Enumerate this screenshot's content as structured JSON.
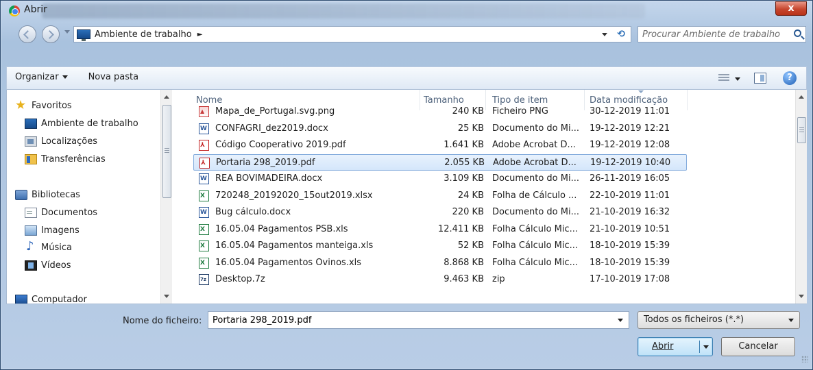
{
  "window": {
    "title": "Abrir",
    "close_label": "x"
  },
  "address_bar": {
    "path": "Ambiente de trabalho",
    "separator": "►"
  },
  "search": {
    "placeholder": "Procurar Ambiente de trabalho"
  },
  "toolbar": {
    "organize_label": "Organizar",
    "new_folder_label": "Nova pasta",
    "help_label": "?"
  },
  "nav": {
    "favorites": "Favoritos",
    "desktop": "Ambiente de trabalho",
    "places": "Localizações",
    "downloads": "Transferências",
    "libraries": "Bibliotecas",
    "documents": "Documentos",
    "images": "Imagens",
    "music": "Música",
    "videos": "Vídeos",
    "computer": "Computador"
  },
  "columns": {
    "name": "Nome",
    "size": "Tamanho",
    "type": "Tipo de item",
    "date": "Data modificação"
  },
  "files": [
    {
      "icon": "png-file-icon",
      "name": "Mapa_de_Portugal.svg.png",
      "size": "240 KB",
      "type": "Ficheiro PNG",
      "date": "30-12-2019 11:01"
    },
    {
      "icon": "word-file-icon",
      "name": "CONFAGRI_dez2019.docx",
      "size": "25 KB",
      "type": "Documento do Mi...",
      "date": "19-12-2019 12:21"
    },
    {
      "icon": "pdf-file-icon",
      "name": "Código Cooperativo 2019.pdf",
      "size": "1.641 KB",
      "type": "Adobe Acrobat D...",
      "date": "19-12-2019 12:08"
    },
    {
      "icon": "pdf-file-icon",
      "name": "Portaria 298_2019.pdf",
      "size": "2.055 KB",
      "type": "Adobe Acrobat D...",
      "date": "19-12-2019 10:40",
      "selected": true
    },
    {
      "icon": "word-file-icon",
      "name": "REA BOVIMADEIRA.docx",
      "size": "3.109 KB",
      "type": "Documento do Mi...",
      "date": "26-11-2019 16:05"
    },
    {
      "icon": "excel-file-icon",
      "name": "720248_20192020_15out2019.xlsx",
      "size": "24 KB",
      "type": "Folha de Cálculo ...",
      "date": "22-10-2019 11:01"
    },
    {
      "icon": "word-file-icon",
      "name": "Bug cálculo.docx",
      "size": "220 KB",
      "type": "Documento do Mi...",
      "date": "21-10-2019 16:32"
    },
    {
      "icon": "excel-file-icon",
      "name": "16.05.04 Pagamentos PSB.xls",
      "size": "12.411 KB",
      "type": "Folha Cálculo Mic...",
      "date": "21-10-2019 10:51"
    },
    {
      "icon": "excel-file-icon",
      "name": "16.05.04 Pagamentos manteiga.xls",
      "size": "52 KB",
      "type": "Folha Cálculo Mic...",
      "date": "18-10-2019 15:39"
    },
    {
      "icon": "excel-file-icon",
      "name": "16.05.04 Pagamentos Ovinos.xls",
      "size": "8.868 KB",
      "type": "Folha Cálculo Mic...",
      "date": "18-10-2019 15:39"
    },
    {
      "icon": "zip-file-icon",
      "name": "Desktop.7z",
      "size": "9.463 KB",
      "type": "zip",
      "date": "17-10-2019 17:08"
    }
  ],
  "filename": {
    "label": "Nome do ficheiro:",
    "value": "Portaria 298_2019.pdf"
  },
  "filter": {
    "selected": "Todos os ficheiros (*.*)"
  },
  "buttons": {
    "open": "Abrir",
    "cancel": "Cancelar"
  }
}
